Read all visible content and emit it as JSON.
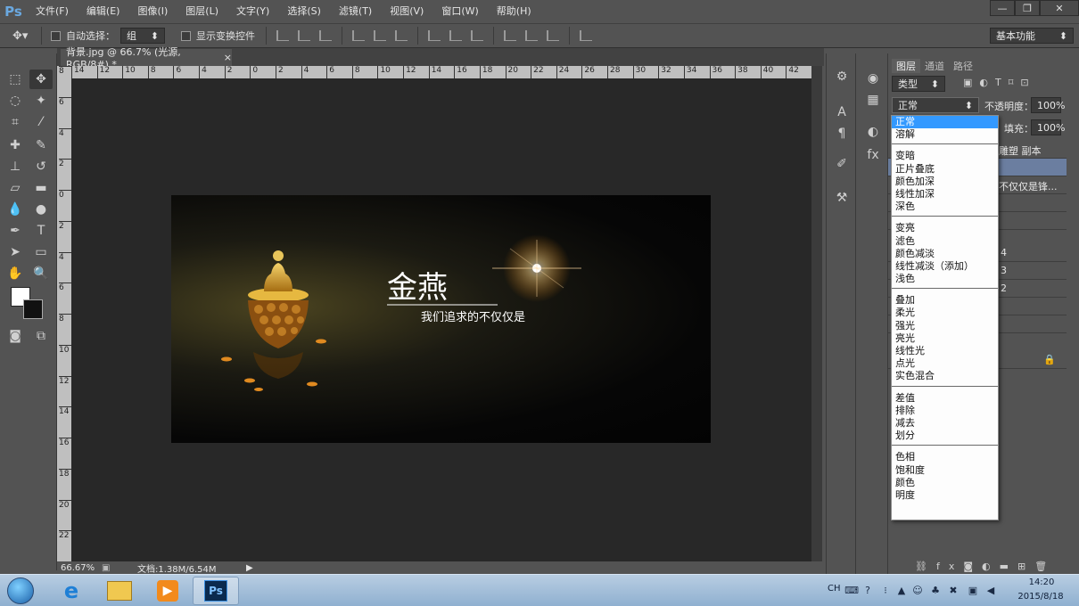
{
  "app": {
    "logo": "Ps"
  },
  "menu": [
    "文件(F)",
    "编辑(E)",
    "图像(I)",
    "图层(L)",
    "文字(Y)",
    "选择(S)",
    "滤镜(T)",
    "视图(V)",
    "窗口(W)",
    "帮助(H)"
  ],
  "window_controls": {
    "minimize": "—",
    "restore": "❐",
    "close": "✕"
  },
  "options": {
    "auto_select_label": "自动选择：",
    "auto_select_value": "组",
    "show_transform_label": "显示变换控件",
    "workspace": "基本功能"
  },
  "document": {
    "tab_title": "背景.jpg @ 66.7% (光源, RGB/8#) *",
    "tab_close": "×",
    "ruler_top_ticks": [
      "14",
      "12",
      "10",
      "8",
      "6",
      "4",
      "2",
      "0",
      "2",
      "4",
      "6",
      "8",
      "10",
      "12",
      "14",
      "16",
      "18",
      "20",
      "22",
      "24",
      "26",
      "28",
      "30",
      "32",
      "34",
      "36",
      "38",
      "40",
      "42"
    ],
    "ruler_left_ticks": [
      "8",
      "6",
      "4",
      "2",
      "0",
      "2",
      "4",
      "6",
      "8",
      "10",
      "12",
      "14",
      "16",
      "18",
      "20",
      "22"
    ],
    "image_title": "金燕",
    "image_subtitle": "我们追求的不仅仅是"
  },
  "status": {
    "zoom": "66.67%",
    "doc_info": "文档:1.38M/6.54M"
  },
  "layers_panel": {
    "tabs": [
      "图层",
      "通道",
      "路径"
    ],
    "filter_label": "类型",
    "blend_mode": "正常",
    "opacity_label": "不透明度：",
    "opacity_value": "100%",
    "fill_label": "填充：",
    "fill_value": "100%",
    "row_texts": [
      "雕塑 副本",
      "不仅仅是锋...",
      "4",
      "3",
      "2"
    ]
  },
  "blend_modes": {
    "group1": [
      "正常",
      "溶解"
    ],
    "group2": [
      "变暗",
      "正片叠底",
      "颜色加深",
      "线性加深",
      "深色"
    ],
    "group3": [
      "变亮",
      "滤色",
      "颜色减淡",
      "线性减淡（添加）",
      "浅色"
    ],
    "group4": [
      "叠加",
      "柔光",
      "强光",
      "亮光",
      "线性光",
      "点光",
      "实色混合"
    ],
    "group5": [
      "差值",
      "排除",
      "减去",
      "划分"
    ],
    "group6": [
      "色相",
      "饱和度",
      "颜色",
      "明度"
    ]
  },
  "taskbar": {
    "ps_label": "Ps",
    "lang": "CH",
    "time": "14:20",
    "date": "2015/8/18"
  },
  "colors": {
    "accent": "#3399ff",
    "ps_blue": "#2a7bd4"
  }
}
